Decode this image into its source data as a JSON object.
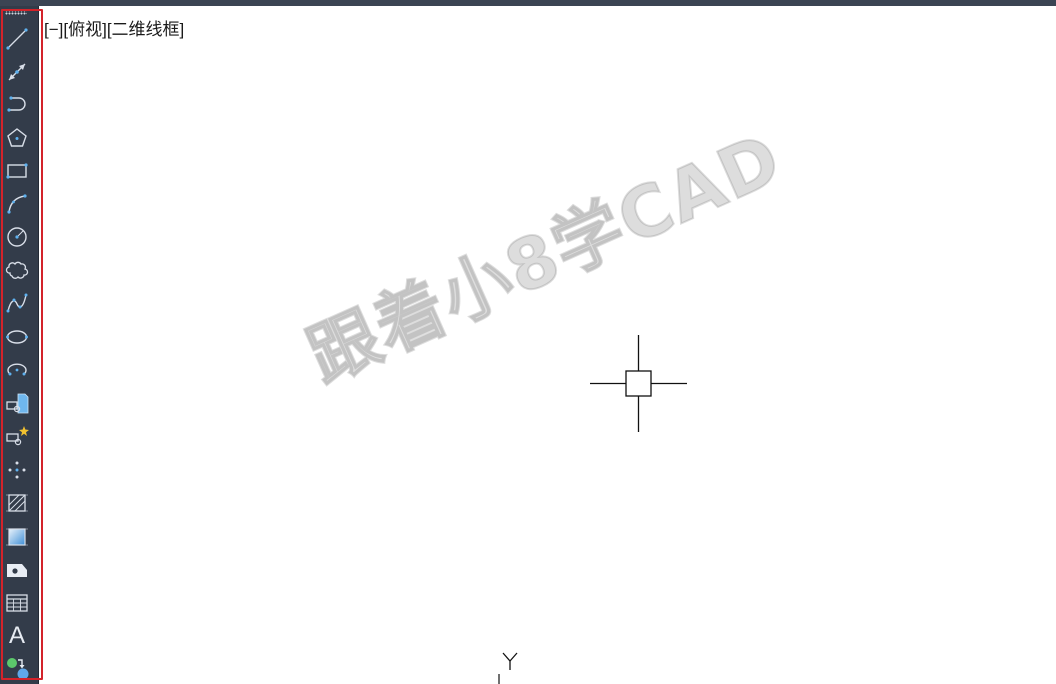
{
  "viewport": {
    "label": "[−][俯视][二维线框]"
  },
  "watermark": {
    "text": "跟着小8学CAD"
  },
  "toolbar": {
    "highlight_color": "#d3232a",
    "tools": [
      {
        "name": "line",
        "icon": "line-icon"
      },
      {
        "name": "construction-line",
        "icon": "construction-line-icon"
      },
      {
        "name": "polyline",
        "icon": "polyline-icon"
      },
      {
        "name": "polygon",
        "icon": "polygon-icon"
      },
      {
        "name": "rectangle",
        "icon": "rectangle-icon"
      },
      {
        "name": "arc",
        "icon": "arc-icon"
      },
      {
        "name": "circle",
        "icon": "circle-icon"
      },
      {
        "name": "revision-cloud",
        "icon": "revision-cloud-icon"
      },
      {
        "name": "spline",
        "icon": "spline-icon"
      },
      {
        "name": "ellipse",
        "icon": "ellipse-icon"
      },
      {
        "name": "ellipse-arc",
        "icon": "ellipse-arc-icon"
      },
      {
        "name": "insert-block",
        "icon": "insert-block-icon"
      },
      {
        "name": "create-block",
        "icon": "create-block-icon"
      },
      {
        "name": "point",
        "icon": "point-icon"
      },
      {
        "name": "hatch",
        "icon": "hatch-icon"
      },
      {
        "name": "gradient",
        "icon": "gradient-icon"
      },
      {
        "name": "region",
        "icon": "region-icon"
      },
      {
        "name": "table",
        "icon": "table-icon"
      },
      {
        "name": "multiline-text",
        "icon": "text-icon",
        "label": "A"
      },
      {
        "name": "add-selected",
        "icon": "add-selected-icon"
      }
    ]
  },
  "ucs": {
    "y_axis_label": "Y"
  }
}
